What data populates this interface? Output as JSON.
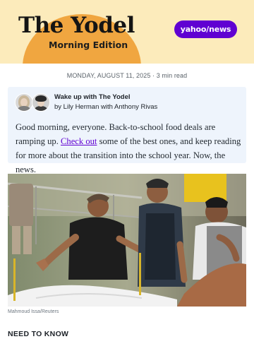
{
  "masthead": {
    "title": "The Yodel",
    "subtitle": "Morning Edition",
    "logo_text": "yahoo/news"
  },
  "dateline": {
    "text": "MONDAY, AUGUST 11, 2025 · 3 min read"
  },
  "intro": {
    "title": "Wake up with The Yodel",
    "byline": "by Lily Herman with Anthony Rivas",
    "body_before_link": "Good morning, everyone. Back-to-school food deals are ramping up. ",
    "link_text": "Check out",
    "body_after_link": " some of the best ones, and keep reading for more about the transition into the school year. Now,  the news."
  },
  "photo": {
    "credit": "Mahmoud Issa/Reuters"
  },
  "sections": {
    "need_to_know": "NEED TO KNOW"
  },
  "colors": {
    "masthead_bg": "#fcebbb",
    "sun": "#f0a640",
    "yahoo_purple": "#6001d2",
    "card_bg": "#eef4fc"
  }
}
